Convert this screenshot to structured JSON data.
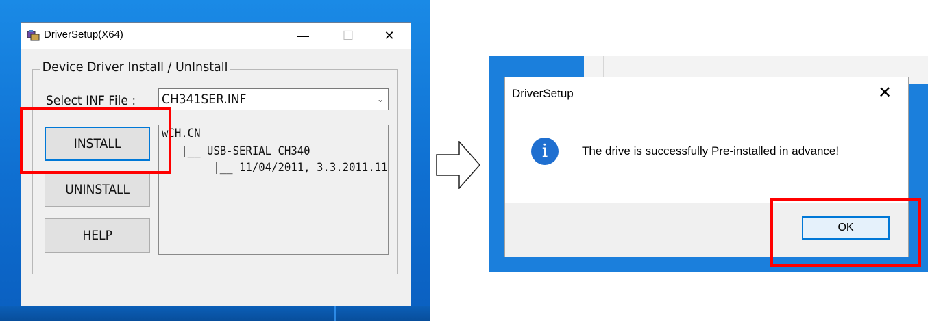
{
  "driver_setup": {
    "window_title": "DriverSetup(X64)",
    "window_controls": {
      "minimize": "—",
      "maximize": "☐",
      "close": "✕"
    },
    "group_title": "Device Driver Install / UnInstall",
    "inf_label": "Select INF File :",
    "inf_value": "CH341SER.INF",
    "buttons": {
      "install": "INSTALL",
      "uninstall": "UNINSTALL",
      "help": "HELP"
    },
    "info_lines": [
      "wCH.CN",
      "   |__ USB-SERIAL CH340",
      "        |__ 11/04/2011, 3.3.2011.11"
    ]
  },
  "message_box": {
    "title": "DriverSetup",
    "close": "✕",
    "icon": "i",
    "message": "The drive is successfully Pre-installed in advance!",
    "ok_label": "OK"
  },
  "colors": {
    "highlight": "#ff0000",
    "focus_border": "#0078d7",
    "desktop": "#1a8ae6",
    "info_icon": "#1f6fd0"
  },
  "icons": [
    "installer-app-icon",
    "chevron-down-icon",
    "info-icon",
    "close-icon",
    "right-arrow-icon"
  ]
}
